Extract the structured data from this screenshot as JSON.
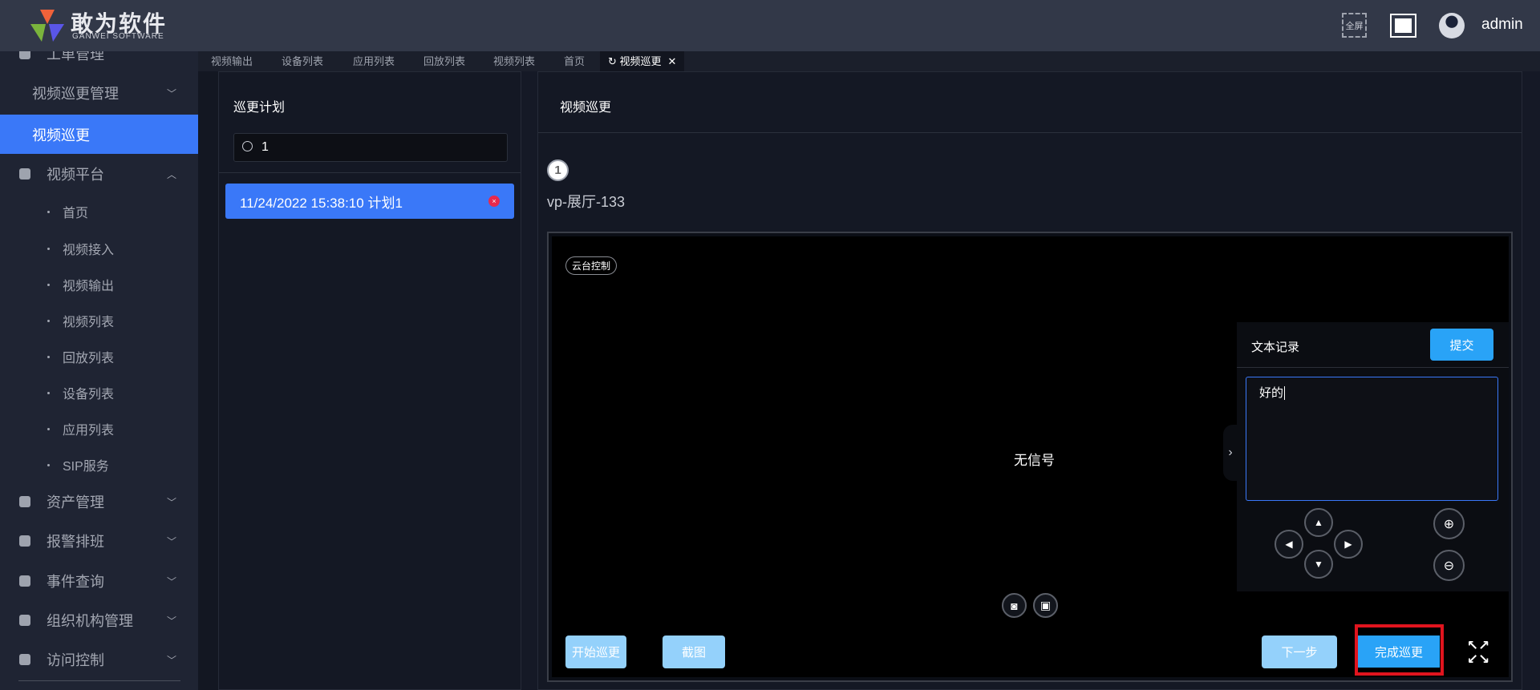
{
  "header": {
    "brand": "敢为软件",
    "brand_sub": "GANWEI SOFTWARE",
    "fullscreen_label": "全屏",
    "user": "admin"
  },
  "sidebar": {
    "items": [
      {
        "label": "工单管理",
        "type": "top"
      },
      {
        "label": "视频巡更管理",
        "type": "group"
      },
      {
        "label": "视频巡更",
        "type": "active"
      },
      {
        "label": "视频平台",
        "type": "top",
        "expanded": true
      },
      {
        "label": "首页",
        "type": "sub"
      },
      {
        "label": "视频接入",
        "type": "sub"
      },
      {
        "label": "视频输出",
        "type": "sub"
      },
      {
        "label": "视频列表",
        "type": "sub"
      },
      {
        "label": "回放列表",
        "type": "sub"
      },
      {
        "label": "设备列表",
        "type": "sub"
      },
      {
        "label": "应用列表",
        "type": "sub"
      },
      {
        "label": "SIP服务",
        "type": "sub"
      },
      {
        "label": "资产管理",
        "type": "top"
      },
      {
        "label": "报警排班",
        "type": "top"
      },
      {
        "label": "事件查询",
        "type": "top"
      },
      {
        "label": "组织机构管理",
        "type": "top"
      },
      {
        "label": "访问控制",
        "type": "top"
      }
    ]
  },
  "tabs": [
    {
      "label": "视频输出"
    },
    {
      "label": "设备列表"
    },
    {
      "label": "应用列表"
    },
    {
      "label": "回放列表"
    },
    {
      "label": "视频列表"
    },
    {
      "label": "首页"
    },
    {
      "label": "视频巡更",
      "active": true
    }
  ],
  "plan_panel": {
    "title": "巡更计划",
    "search_value": "1",
    "items": [
      {
        "label": "11/24/2022 15:38:10 计划1",
        "selected": true
      }
    ]
  },
  "main": {
    "title": "视频巡更",
    "step_number": "1",
    "camera_name": "vp-展厅-133",
    "ptz_label": "云台控制",
    "no_signal": "无信号",
    "record": {
      "title": "文本记录",
      "submit": "提交",
      "text": "好的"
    },
    "buttons": {
      "start": "开始巡更",
      "screenshot": "截图",
      "next": "下一步",
      "finish": "完成巡更"
    }
  },
  "colors": {
    "accent": "#3a78f8",
    "button_blue": "#29a3f7",
    "button_light": "#94d1fb",
    "highlight": "#e0141e"
  }
}
